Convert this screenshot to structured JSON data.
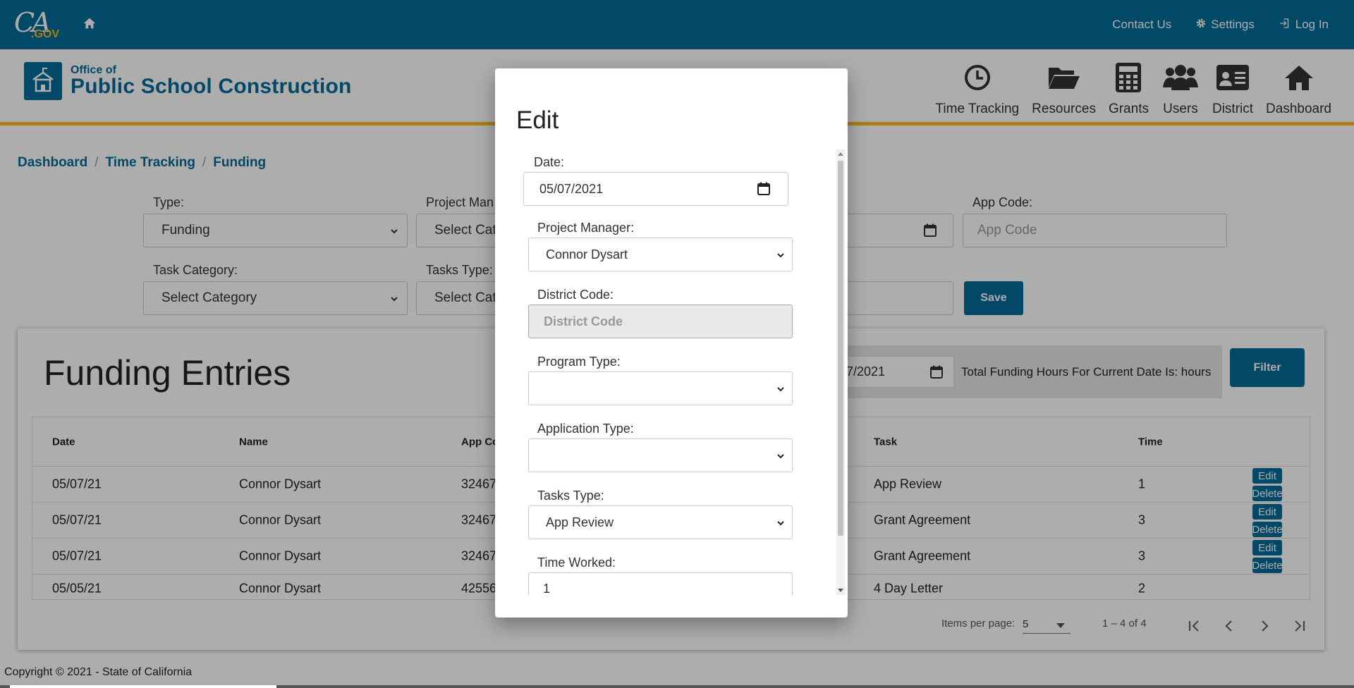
{
  "colors": {
    "brand_blue": "#046b99",
    "accent_gold": "#fdb81e"
  },
  "topbar": {
    "logo_ca": "CA",
    "logo_gov": ".GOV",
    "links": {
      "contact": "Contact Us",
      "settings": "Settings",
      "login": "Log In"
    }
  },
  "header": {
    "logo_line1": "Office of",
    "logo_line2": "Public School Construction",
    "nav": {
      "time_tracking": "Time Tracking",
      "resources": "Resources",
      "grants": "Grants",
      "users": "Users",
      "district": "District",
      "dashboard": "Dashboard"
    }
  },
  "breadcrumb": {
    "item1": "Dashboard",
    "sep": "/",
    "item2": "Time Tracking",
    "item3": "Funding"
  },
  "filters": {
    "type_label": "Type:",
    "type_value": "Funding",
    "project_manager_label": "Project Man",
    "project_manager_value": "Select Cat",
    "app_code_label": "App Code:",
    "app_code_placeholder": "App Code",
    "task_category_label": "Task Category:",
    "task_category_value": "Select Category",
    "tasks_type_label": "Tasks Type:",
    "tasks_type_value": "Select Cat",
    "save_label": "Save"
  },
  "entries": {
    "title": "Funding Entries",
    "date_value": "7/2021",
    "hours_text": "Total Funding Hours For Current Date Is: hours",
    "filter_label": "Filter",
    "columns": {
      "date": "Date",
      "name": "Name",
      "app_code": "App Co",
      "task": "Task",
      "time": "Time"
    },
    "rows": [
      {
        "date": "05/07/21",
        "name": "Connor Dysart",
        "app_code": "32467",
        "task": "App Review",
        "time": "1"
      },
      {
        "date": "05/07/21",
        "name": "Connor Dysart",
        "app_code": "32467",
        "task": "Grant Agreement",
        "time": "3"
      },
      {
        "date": "05/07/21",
        "name": "Connor Dysart",
        "app_code": "32467",
        "task": "Grant Agreement",
        "time": "3"
      },
      {
        "date": "05/05/21",
        "name": "Connor Dysart",
        "app_code": "42556",
        "task": "4 Day Letter",
        "time": "2"
      }
    ],
    "edit_label": "Edit",
    "delete_label": "Delete",
    "pager": {
      "items_label": "Items per page:",
      "per_page": "5",
      "range": "1 – 4 of 4"
    }
  },
  "footer": {
    "copyright": "Copyright © 2021 - State of California"
  },
  "modal": {
    "title": "Edit",
    "date_label": "Date:",
    "date_value": "05/07/2021",
    "project_manager_label": "Project Manager:",
    "project_manager_value": "Connor Dysart",
    "district_code_label": "District Code:",
    "district_code_placeholder": "District Code",
    "program_type_label": "Program Type:",
    "program_type_value": "",
    "application_type_label": "Application Type:",
    "application_type_value": "",
    "tasks_type_label": "Tasks Type:",
    "tasks_type_value": "App Review",
    "time_worked_label": "Time Worked:",
    "time_worked_value": "1"
  }
}
